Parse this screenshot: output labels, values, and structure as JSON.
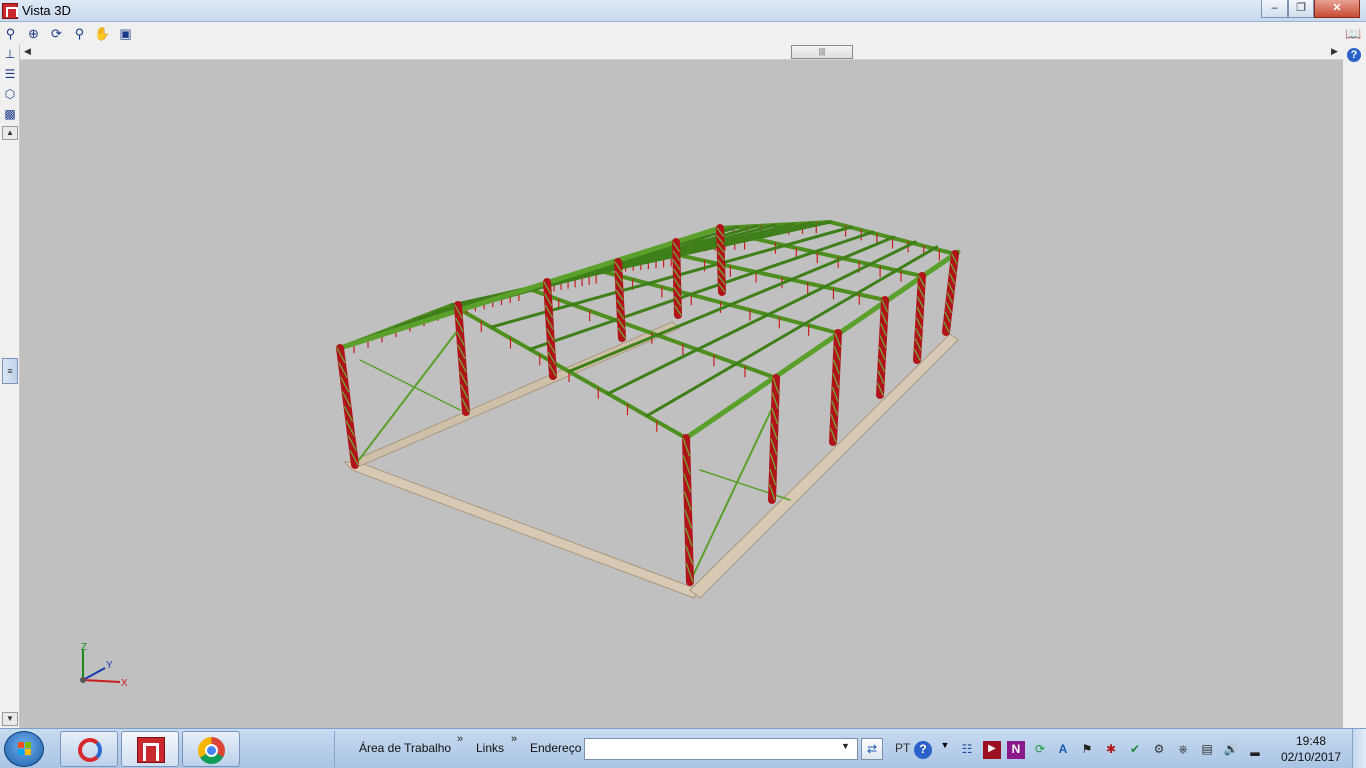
{
  "window": {
    "title": "Vista 3D",
    "icon": "cypecad-app-icon"
  },
  "titlebar_buttons": {
    "minimize": "minimize-icon",
    "restore": "restore-icon",
    "close": "close-icon"
  },
  "toolbar": {
    "items": [
      "zoom-window-icon",
      "zoom-all-icon",
      "orbit-icon",
      "zoom-icon",
      "pan-hand-icon",
      "fit-view-icon"
    ],
    "right_items": [
      "book-icon",
      "help-icon"
    ]
  },
  "leftbar": {
    "items": [
      "axis-icon",
      "layers-icon",
      "cube-icon",
      "render-icon"
    ]
  },
  "axes_gizmo": {
    "z": "Z",
    "y": "Y",
    "x": "X"
  },
  "taskbar": {
    "toolbars": [
      {
        "label": "Área de Trabalho"
      },
      {
        "label": "Links"
      }
    ],
    "address_label": "Endereço",
    "address_value": "",
    "language": "PT",
    "clock": {
      "time": "19:48",
      "date": "02/10/2017"
    },
    "pinned_apps": [
      "sync-app-icon",
      "cype-app-icon",
      "chrome-icon"
    ]
  }
}
